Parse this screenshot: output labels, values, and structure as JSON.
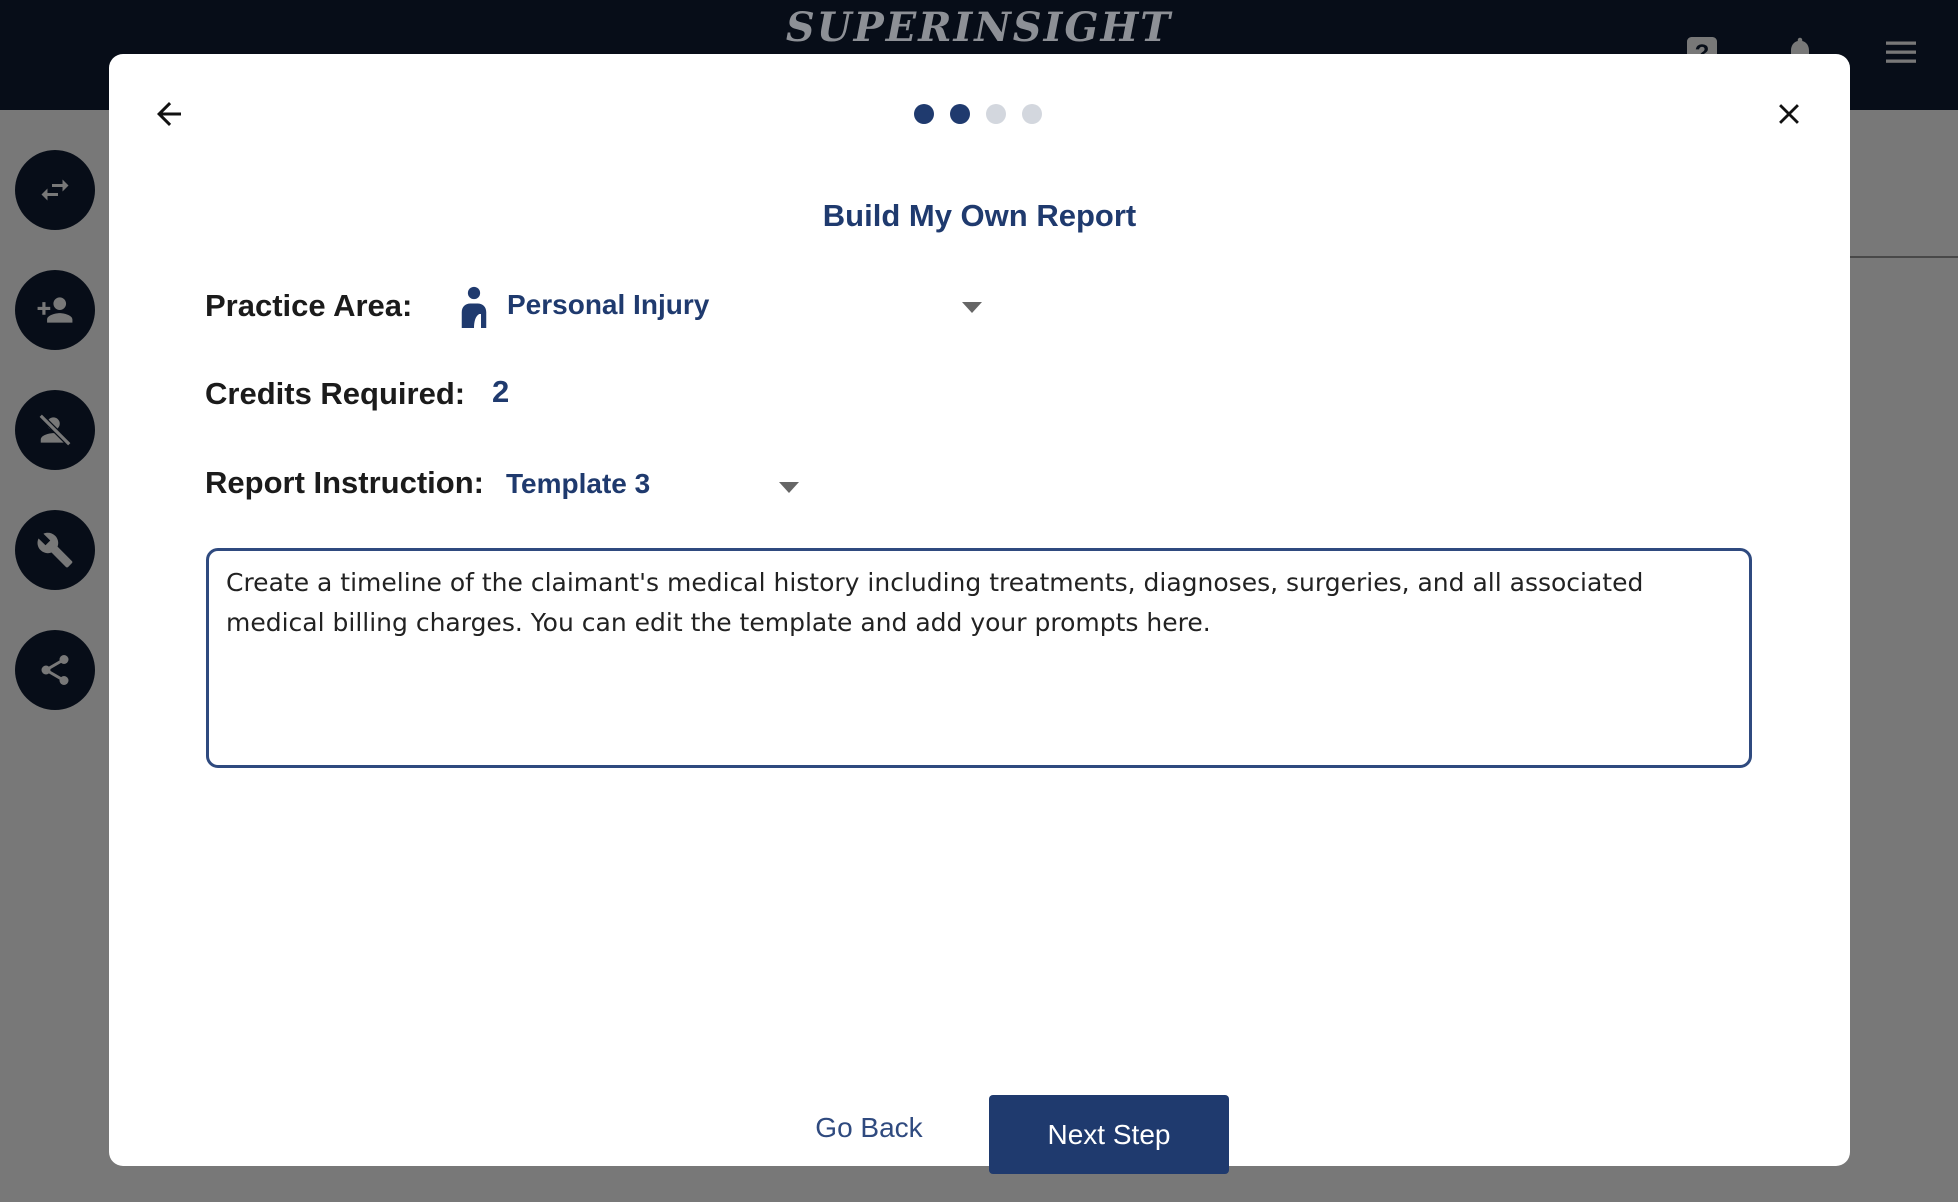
{
  "header": {
    "logo": "SUPERINSIGHT",
    "icons": [
      "help-icon",
      "bell-icon",
      "menu-icon"
    ]
  },
  "sidebar": {
    "items": [
      {
        "icon": "swap-icon"
      },
      {
        "icon": "add-person-icon"
      },
      {
        "icon": "person-off-icon"
      },
      {
        "icon": "wrench-icon"
      },
      {
        "icon": "share-icon"
      }
    ]
  },
  "modal": {
    "steps_total": 4,
    "steps_done": 2,
    "title": "Build My Own Report",
    "practice_area": {
      "label": "Practice Area:",
      "value": "Personal Injury",
      "icon": "injured-person-icon"
    },
    "credits": {
      "label": "Credits Required:",
      "value": "2"
    },
    "report_instruction": {
      "label": "Report Instruction:",
      "value": "Template 3"
    },
    "instruction_text": "Create a timeline of the claimant's medical history including treatments, diagnoses, surgeries, and all associated medical billing charges. You can edit the template and add your prompts here.",
    "go_back": "Go Back",
    "next_step": "Next Step"
  },
  "colors": {
    "header": "#0f1d33",
    "accent": "#1f3a6e",
    "dot_inactive": "#d3d7de"
  }
}
